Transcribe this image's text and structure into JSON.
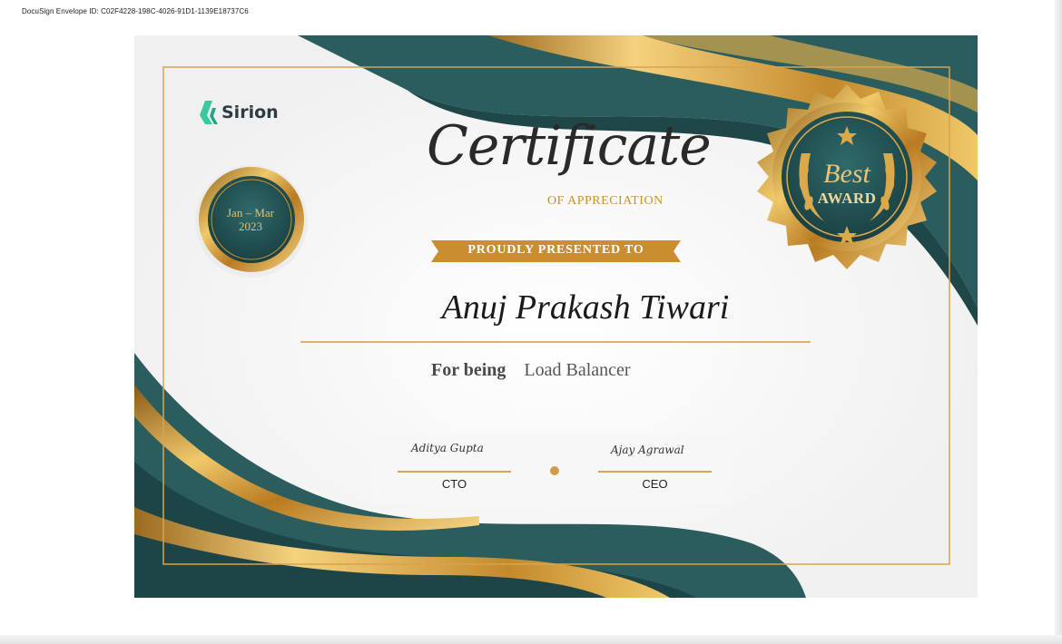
{
  "envelope_id": "DocuSign Envelope ID: C02F4228-198C-4026-91D1-1139E18737C6",
  "brand": {
    "name": "Sirion",
    "logo_icon": "sirion-logo-icon",
    "logo_color": "#3ac8a3"
  },
  "certificate": {
    "title": "Certificate",
    "subtitle": "OF APPRECIATION",
    "presented_label": "PROUDLY PRESENTED TO",
    "recipient": "Anuj Prakash Tiwari",
    "reason_label": "For being",
    "reason_value": "Load Balancer"
  },
  "period_badge": {
    "line1": "Jan – Mar",
    "line2": "2023"
  },
  "award_badge": {
    "line1": "Best",
    "line2": "AWARD",
    "icons": [
      "star-icon",
      "laurel-wreath-icon"
    ]
  },
  "signatures": [
    {
      "signature": "Aditya Gupta",
      "title": "CTO"
    },
    {
      "signature": "Ajay Agrawal",
      "title": "CEO"
    }
  ],
  "colors": {
    "teal": "#2a5a5c",
    "gold": "#c9922e",
    "gold_light": "#f0c96a",
    "background": "#f4f4f4"
  }
}
